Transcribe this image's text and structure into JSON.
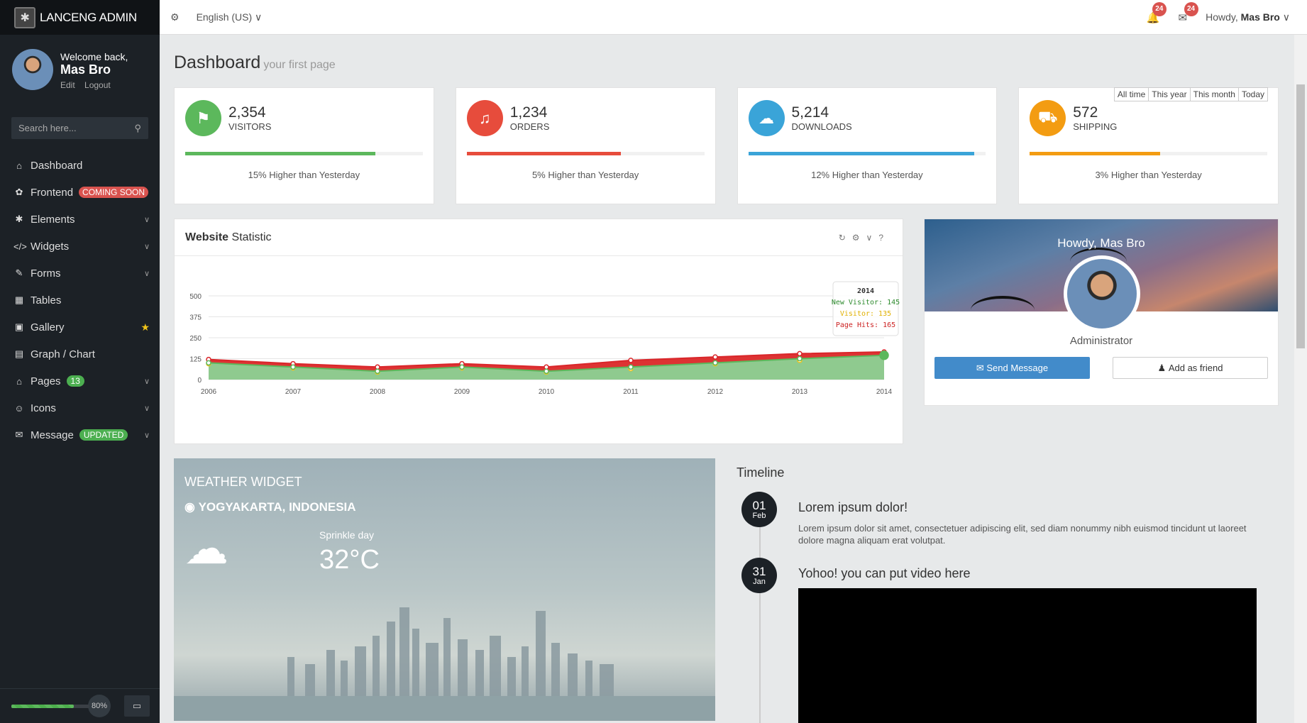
{
  "brand": {
    "name": "LANCENG ADMIN"
  },
  "user": {
    "welcome": "Welcome back,",
    "name": "Mas Bro",
    "edit": "Edit",
    "logout": "Logout"
  },
  "sidebar": {
    "search_placeholder": "Search here...",
    "items": [
      {
        "label": "Dashboard",
        "icon": "home-icon"
      },
      {
        "label": "Frontend",
        "icon": "leaf-icon",
        "badge": "COMING SOON"
      },
      {
        "label": "Elements",
        "icon": "bug-icon"
      },
      {
        "label": "Widgets",
        "icon": "code-icon"
      },
      {
        "label": "Forms",
        "icon": "edit-icon"
      },
      {
        "label": "Tables",
        "icon": "table-icon"
      },
      {
        "label": "Gallery",
        "icon": "image-icon"
      },
      {
        "label": "Graph / Chart",
        "icon": "chart-icon"
      },
      {
        "label": "Pages",
        "icon": "home-icon",
        "badge": "13"
      },
      {
        "label": "Icons",
        "icon": "smile-icon"
      },
      {
        "label": "Message",
        "icon": "envelope-icon",
        "badge": "UPDATED"
      }
    ],
    "progress": {
      "value": 0.8,
      "label": "80%"
    }
  },
  "topbar": {
    "language": "English (US)",
    "notifications": "24",
    "messages": "24",
    "howdy": "Howdy,",
    "user": "Mas Bro"
  },
  "page": {
    "title": "Dashboard",
    "subtitle": "your first page"
  },
  "stats": [
    {
      "value": "2,354",
      "label": "VISITORS",
      "foot": "15% Higher than Yesterday",
      "color": "#5cb85c",
      "progress": 0.8,
      "icon": "flag-icon"
    },
    {
      "value": "1,234",
      "label": "ORDERS",
      "foot": "5% Higher than Yesterday",
      "color": "#e74c3c",
      "progress": 0.65,
      "icon": "bell-icon"
    },
    {
      "value": "5,214",
      "label": "DOWNLOADS",
      "foot": "12% Higher than Yesterday",
      "color": "#3aa4d8",
      "progress": 0.95,
      "icon": "cloud-download-icon"
    },
    {
      "value": "572",
      "label": "SHIPPING",
      "foot": "3% Higher than Yesterday",
      "color": "#f39c12",
      "progress": 0.55,
      "icon": "truck-icon"
    }
  ],
  "statistic_panel": {
    "title_bold": "Website",
    "title_rest": "Statistic",
    "ranges": [
      "All time",
      "This year",
      "This month",
      "Today"
    ],
    "tooltip": {
      "year": "2014",
      "new_visitor": "New Visitor: 145",
      "visitor": "Visitor: 135",
      "page_hits": "Page Hits: 165"
    }
  },
  "chart_data": {
    "type": "area",
    "x": [
      "2006",
      "2007",
      "2008",
      "2009",
      "2010",
      "2011",
      "2012",
      "2013",
      "2014"
    ],
    "yticks": [
      0,
      125,
      250,
      375,
      500
    ],
    "ylim": [
      0,
      500
    ],
    "series": [
      {
        "name": "New Visitor",
        "color": "#5cb85c",
        "values": [
          100,
          75,
          50,
          75,
          50,
          75,
          100,
          125,
          145
        ]
      },
      {
        "name": "Visitor",
        "color": "#f0c419",
        "values": [
          95,
          70,
          45,
          70,
          45,
          65,
          95,
          115,
          135
        ]
      },
      {
        "name": "Page Hits",
        "color": "#d9262a",
        "values": [
          120,
          95,
          75,
          95,
          75,
          115,
          135,
          155,
          165
        ]
      }
    ]
  },
  "profile": {
    "title": "Howdy, Mas Bro",
    "role": "Administrator",
    "send": "Send Message",
    "add": "Add as friend"
  },
  "weather": {
    "title": "WEATHER WIDGET",
    "location": "YOGYAKARTA, INDONESIA",
    "desc": "Sprinkle day",
    "temp": "32°C"
  },
  "timeline": {
    "title": "Timeline",
    "items": [
      {
        "day": "01",
        "month": "Feb",
        "head": "Lorem ipsum dolor!",
        "text": "Lorem ipsum dolor sit amet, consectetuer adipiscing elit, sed diam nonummy nibh euismod tincidunt ut laoreet dolore magna aliquam erat volutpat."
      },
      {
        "day": "31",
        "month": "Jan",
        "head": "Yohoo! you can put video here",
        "text": ""
      }
    ]
  }
}
